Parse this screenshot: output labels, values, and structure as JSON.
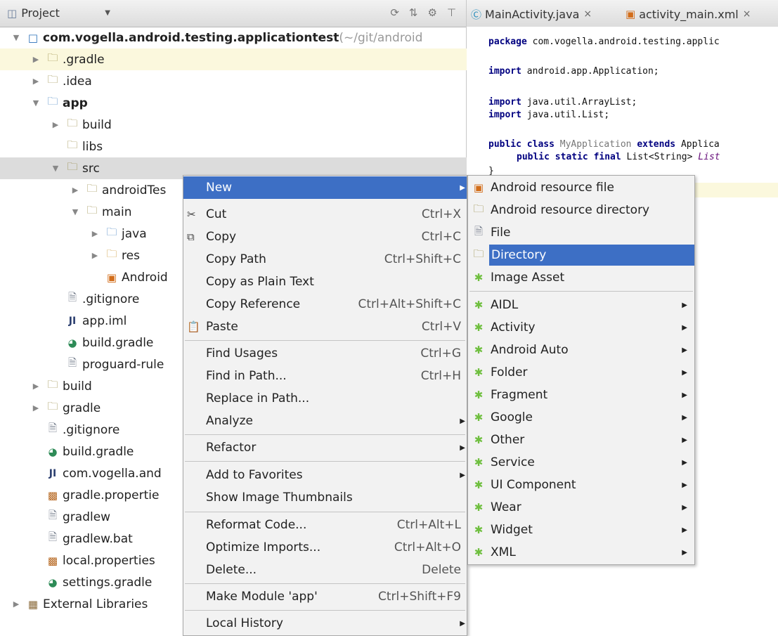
{
  "project_header": {
    "title": "Project"
  },
  "tree": [
    {
      "label": "com.vogella.android.testing.applicationtest",
      "suffix": " (~/git/android",
      "icon": "module-icon",
      "bold": true
    },
    {
      "label": ".gradle",
      "icon": "folder-icon"
    },
    {
      "label": ".idea",
      "icon": "folder-icon"
    },
    {
      "label": "app",
      "icon": "module-folder-icon",
      "bold": true
    },
    {
      "label": "build",
      "icon": "folder-icon"
    },
    {
      "label": "libs",
      "icon": "folder-icon"
    },
    {
      "label": "src",
      "icon": "folder-icon"
    },
    {
      "label": "androidTes",
      "icon": "folder-icon"
    },
    {
      "label": "main",
      "icon": "folder-icon"
    },
    {
      "label": "java",
      "icon": "source-folder-icon"
    },
    {
      "label": "res",
      "icon": "resource-folder-icon"
    },
    {
      "label": "Android",
      "icon": "xml-file-icon"
    },
    {
      "label": ".gitignore",
      "icon": "text-file-icon"
    },
    {
      "label": "app.iml",
      "icon": "iml-file-icon"
    },
    {
      "label": "build.gradle",
      "icon": "gradle-file-icon"
    },
    {
      "label": "proguard-rule",
      "icon": "text-file-icon"
    },
    {
      "label": "build",
      "icon": "folder-icon"
    },
    {
      "label": "gradle",
      "icon": "folder-icon"
    },
    {
      "label": ".gitignore",
      "icon": "text-file-icon"
    },
    {
      "label": "build.gradle",
      "icon": "gradle-file-icon"
    },
    {
      "label": "com.vogella.and",
      "icon": "iml-file-icon"
    },
    {
      "label": "gradle.propertie",
      "icon": "properties-file-icon"
    },
    {
      "label": "gradlew",
      "icon": "text-file-icon"
    },
    {
      "label": "gradlew.bat",
      "icon": "text-file-icon"
    },
    {
      "label": "local.properties",
      "icon": "properties-file-icon"
    },
    {
      "label": "settings.gradle",
      "icon": "gradle-file-icon"
    },
    {
      "label": "External Libraries",
      "icon": "library-icon"
    }
  ],
  "editor_tabs": [
    {
      "label": "MainActivity.java",
      "icon": "java-class-icon"
    },
    {
      "label": "activity_main.xml",
      "icon": "xml-file-icon"
    }
  ],
  "code": {
    "l1_kw": "package",
    "l1_rest": " com.vogella.android.testing.applic",
    "l2_kw": "import",
    "l2_rest": " android.app.Application;",
    "l3_kw": "import",
    "l3_rest": " java.util.ArrayList;",
    "l4_kw": "import",
    "l4_rest": " java.util.List;",
    "l5_kw1": "public class",
    "l5_name": " MyApplication ",
    "l5_kw2": "extends",
    "l5_rest": " Applica",
    "l6_kw": "public static final",
    "l6_rest": " List<String> ",
    "l6_ital": "List",
    "l7": "}"
  },
  "context_menu": {
    "new": "New",
    "cut": "Cut",
    "cut_sc": "Ctrl+X",
    "copy": "Copy",
    "copy_sc": "Ctrl+C",
    "copy_path": "Copy Path",
    "copy_path_sc": "Ctrl+Shift+C",
    "copy_plain": "Copy as Plain Text",
    "copy_ref": "Copy Reference",
    "copy_ref_sc": "Ctrl+Alt+Shift+C",
    "paste": "Paste",
    "paste_sc": "Ctrl+V",
    "find_usages": "Find Usages",
    "find_usages_sc": "Ctrl+G",
    "find_in_path": "Find in Path...",
    "find_in_path_sc": "Ctrl+H",
    "replace_in_path": "Replace in Path...",
    "analyze": "Analyze",
    "refactor": "Refactor",
    "add_favorites": "Add to Favorites",
    "show_thumbnails": "Show Image Thumbnails",
    "reformat": "Reformat Code...",
    "reformat_sc": "Ctrl+Alt+L",
    "optimize": "Optimize Imports...",
    "optimize_sc": "Ctrl+Alt+O",
    "delete": "Delete...",
    "delete_sc": "Delete",
    "make_module": "Make Module 'app'",
    "make_module_sc": "Ctrl+Shift+F9",
    "local_history": "Local History"
  },
  "new_submenu": [
    {
      "label": "Android resource file",
      "icon": "android-resource-file-icon",
      "sub": false
    },
    {
      "label": "Android resource directory",
      "icon": "folder-icon",
      "sub": false
    },
    {
      "label": "File",
      "icon": "file-icon",
      "sub": false
    },
    {
      "label": "Directory",
      "icon": "folder-icon",
      "sub": false,
      "selected": true
    },
    {
      "label": "Image Asset",
      "icon": "android-icon",
      "sub": false
    },
    {
      "label": "AIDL",
      "icon": "android-icon",
      "sub": true
    },
    {
      "label": "Activity",
      "icon": "android-icon",
      "sub": true
    },
    {
      "label": "Android Auto",
      "icon": "android-icon",
      "sub": true
    },
    {
      "label": "Folder",
      "icon": "android-icon",
      "sub": true
    },
    {
      "label": "Fragment",
      "icon": "android-icon",
      "sub": true
    },
    {
      "label": "Google",
      "icon": "android-icon",
      "sub": true
    },
    {
      "label": "Other",
      "icon": "android-icon",
      "sub": true
    },
    {
      "label": "Service",
      "icon": "android-icon",
      "sub": true
    },
    {
      "label": "UI Component",
      "icon": "android-icon",
      "sub": true
    },
    {
      "label": "Wear",
      "icon": "android-icon",
      "sub": true
    },
    {
      "label": "Widget",
      "icon": "android-icon",
      "sub": true
    },
    {
      "label": "XML",
      "icon": "android-icon",
      "sub": true
    }
  ],
  "colors": {
    "selection": "#3d6fc5",
    "caret_row": "#fbf8dd",
    "android": "#6fbf3f"
  }
}
